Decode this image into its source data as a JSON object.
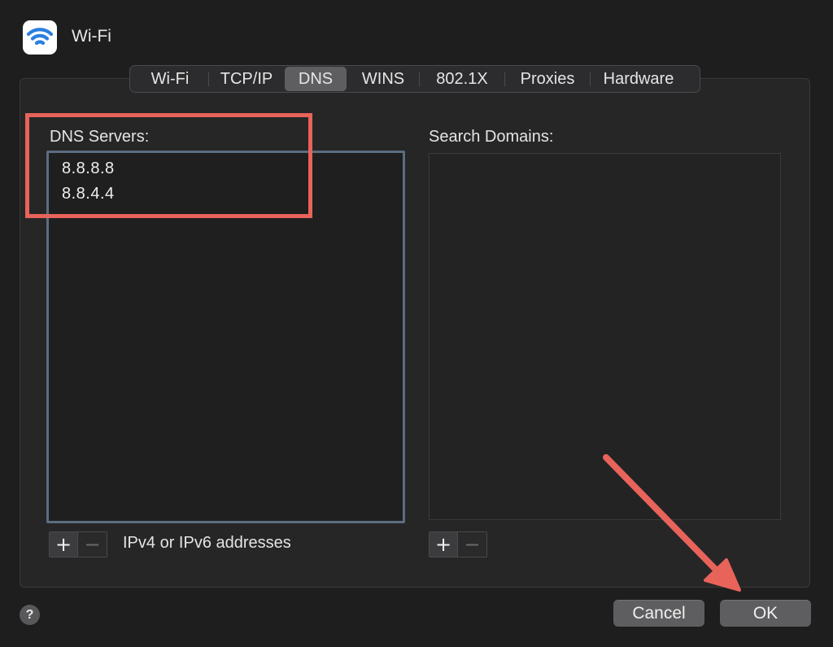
{
  "window": {
    "title": "Wi-Fi",
    "app_icon": "wifi-icon"
  },
  "tabs": [
    {
      "label": "Wi-Fi",
      "active": false
    },
    {
      "label": "TCP/IP",
      "active": false
    },
    {
      "label": "DNS",
      "active": true
    },
    {
      "label": "WINS",
      "active": false
    },
    {
      "label": "802.1X",
      "active": false
    },
    {
      "label": "Proxies",
      "active": false
    },
    {
      "label": "Hardware",
      "active": false
    }
  ],
  "dns": {
    "label": "DNS Servers:",
    "servers": [
      "8.8.8.8",
      "8.8.4.4"
    ],
    "hint": "IPv4 or IPv6 addresses",
    "add_symbol": "+",
    "remove_symbol": "−"
  },
  "search_domains": {
    "label": "Search Domains:",
    "items": [],
    "add_symbol": "+",
    "remove_symbol": "−"
  },
  "footer": {
    "help_symbol": "?",
    "cancel_label": "Cancel",
    "ok_label": "OK"
  },
  "colors": {
    "annotation": "#e8635a",
    "wifi_icon": "#2a7fe0",
    "list_focus_border": "#5b6d80"
  }
}
